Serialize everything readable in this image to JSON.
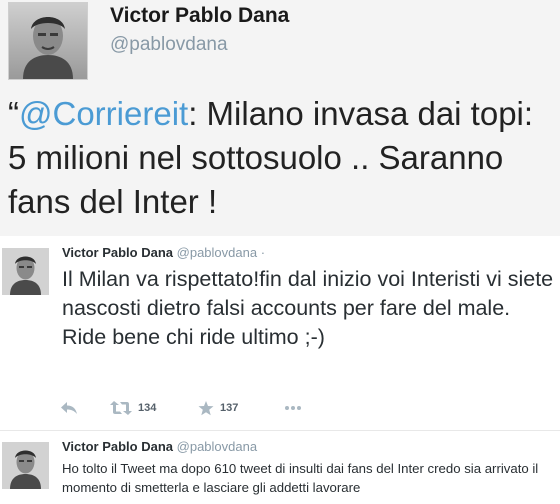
{
  "hero": {
    "name": "Victor Pablo Dana",
    "handle": "@pablovdana",
    "quote_mark": "“",
    "mention": "@Corriereit",
    "text": ": Milano invasa  dai topi: 5  milioni nel sottosuolo  .. Saranno fans del Inter !"
  },
  "tweets": [
    {
      "name": "Victor Pablo Dana",
      "handle": "@pablovdana",
      "handle_suffix": " · ",
      "text": "Il Milan va rispettato!fin dal inizio voi Interisti vi siete nascosti dietro falsi accounts per fare del male. Ride bene chi ride ultimo ;-)",
      "actions": {
        "reply_icon": "reply-arrow",
        "retweet_icon": "retweet-arrows",
        "retweet_count": "134",
        "favorite_icon": "star",
        "favorite_count": "137",
        "more_icon": "more-dots"
      }
    },
    {
      "name": "Victor Pablo Dana",
      "handle": "@pablovdana",
      "text": "Ho tolto il Tweet ma dopo 610 tweet di insulti dai fans del Inter credo sia arrivato il momento di smetterla e lasciare gli addetti lavorare"
    }
  ],
  "colors": {
    "mention": "#4b9bd4",
    "action_gray": "#aab8c2",
    "handle_gray": "#8899a6"
  }
}
